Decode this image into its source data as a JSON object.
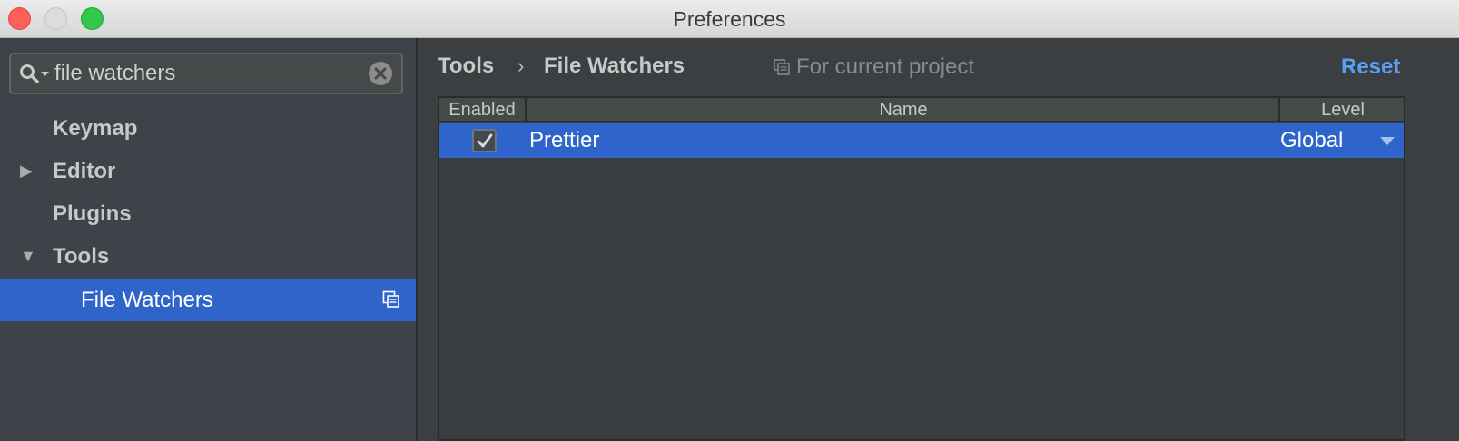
{
  "window": {
    "title": "Preferences"
  },
  "sidebar": {
    "search": {
      "value": "file watchers"
    },
    "items": [
      {
        "label": "Keymap",
        "arrow": ""
      },
      {
        "label": "Editor",
        "arrow": "▶"
      },
      {
        "label": "Plugins",
        "arrow": ""
      },
      {
        "label": "Tools",
        "arrow": "▼"
      },
      {
        "label": "File Watchers",
        "arrow": "",
        "selected": true
      }
    ]
  },
  "main": {
    "breadcrumb": {
      "parent": "Tools",
      "separator": "›",
      "current": "File Watchers"
    },
    "scope_label": "For current project",
    "reset_label": "Reset",
    "table": {
      "columns": [
        "Enabled",
        "Name",
        "Level"
      ],
      "rows": [
        {
          "enabled": true,
          "name": "Prettier",
          "level": "Global"
        }
      ]
    }
  },
  "colors": {
    "selection": "#2f65ca",
    "link": "#589df6",
    "background": "#3c3f41"
  },
  "icons": {
    "search": "magnifier-with-dropdown-icon",
    "clear": "clear-circle-x-icon",
    "project_scope": "project-scope-icon",
    "checkbox": "checkmark-icon",
    "dropdown": "triangle-down-icon"
  }
}
